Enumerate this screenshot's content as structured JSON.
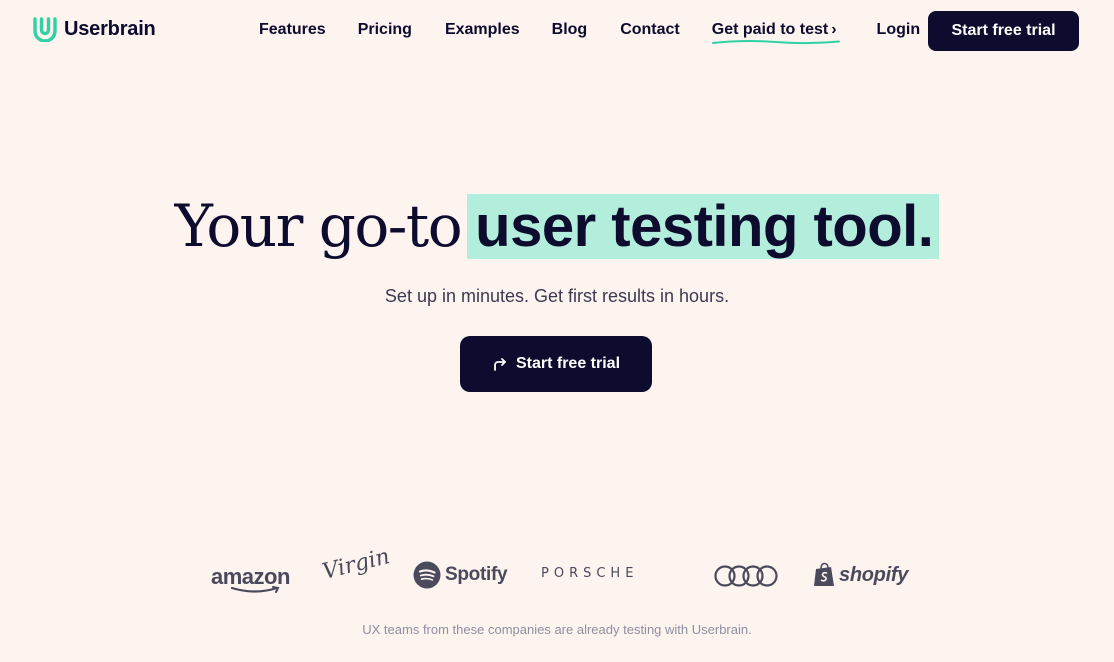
{
  "brand": {
    "name": "Userbrain",
    "logo_icon": "userbrain-u-icon",
    "accent_color": "#31d1a5"
  },
  "nav": {
    "items": [
      {
        "label": "Features"
      },
      {
        "label": "Pricing"
      },
      {
        "label": "Examples"
      },
      {
        "label": "Blog"
      },
      {
        "label": "Contact"
      }
    ],
    "get_paid": {
      "label": "Get paid to test",
      "chevron": "›"
    },
    "login": "Login",
    "cta": "Start free trial"
  },
  "hero": {
    "title_plain": "Your go-to",
    "title_highlight": "user testing tool.",
    "highlight_color": "#b3eddb",
    "subtitle": "Set up in minutes. Get first results in hours.",
    "cta": "Start free trial",
    "cta_icon": "arrow-turn-right-icon"
  },
  "logos": {
    "companies": [
      "amazon",
      "Virgin",
      "Spotify",
      "PORSCHE",
      "Audi",
      "shopify"
    ],
    "caption": "UX teams from these companies are already testing with Userbrain."
  },
  "colors": {
    "background": "#fdf3ef",
    "text_dark": "#0d0b2e",
    "button_bg": "#0d0b2e",
    "logo_gray": "#4a4a5c"
  }
}
